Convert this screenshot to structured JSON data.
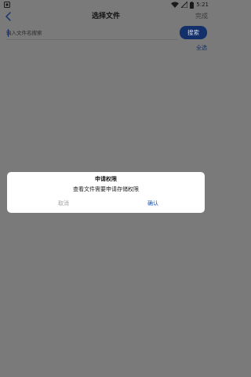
{
  "status_bar": {
    "time": "5:21",
    "notification_icon": "notification-square-icon",
    "wifi_icon": "wifi-icon",
    "signal_icon": "signal-icon",
    "battery_icon": "battery-icon"
  },
  "header": {
    "back_icon": "chevron-left-icon",
    "title": "选择文件",
    "done_label": "完成"
  },
  "search": {
    "placeholder": "输入文件名搜索",
    "value": "",
    "button_label": "搜索"
  },
  "select_all_label": "全选",
  "dialog": {
    "title": "申请权限",
    "message": "查看文件需要申请存储权限",
    "cancel_label": "取消",
    "confirm_label": "确认"
  },
  "colors": {
    "overlay_background": "#7a7a7a",
    "accent": "#13306a",
    "confirm_text": "#1e55b3",
    "cancel_text": "#a2a2a2"
  }
}
